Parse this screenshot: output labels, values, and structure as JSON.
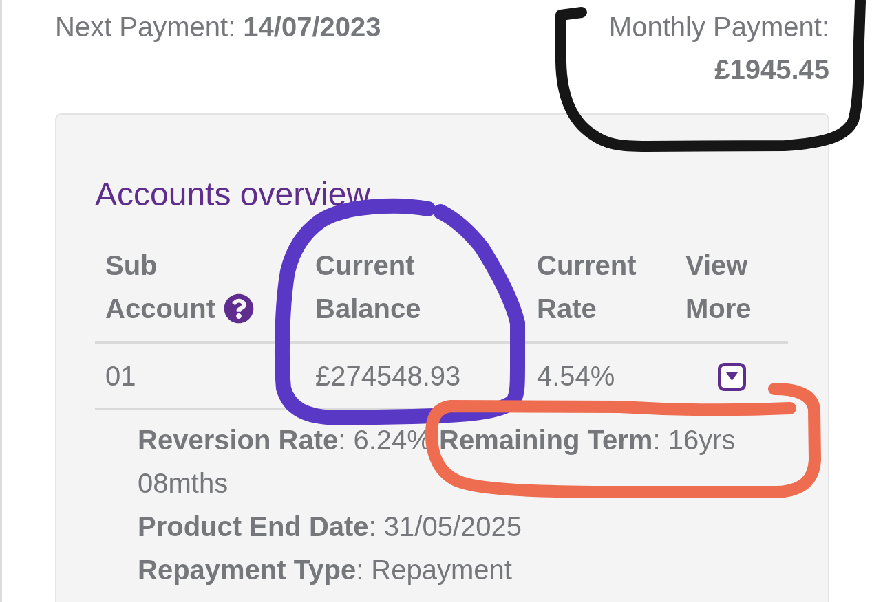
{
  "summary": {
    "next_payment": {
      "label": "Next Payment:",
      "value": "14/07/2023"
    },
    "monthly_payment": {
      "label": "Monthly Payment:",
      "value": "£1945.45"
    }
  },
  "accounts": {
    "title": "Accounts overview",
    "columns": [
      {
        "label": "Sub Account",
        "help": true
      },
      {
        "label": "Current Balance",
        "help": false
      },
      {
        "label": "Current Rate",
        "help": false
      },
      {
        "label": "View More",
        "help": false
      }
    ],
    "rows": [
      {
        "sub_account": "01",
        "current_balance": "£274548.93",
        "current_rate": "4.54%",
        "expanded": true,
        "details": [
          "**Reversion Rate**: 6.24% **Remaining Term**: 16yrs 08mths",
          "**Product End Date**: 31/05/2025",
          "**Repayment Type**: Repayment"
        ]
      }
    ]
  },
  "annotations": [
    {
      "color": "#161616"
    },
    {
      "color": "#5a38c6"
    },
    {
      "color": "#ee6c4f"
    }
  ]
}
